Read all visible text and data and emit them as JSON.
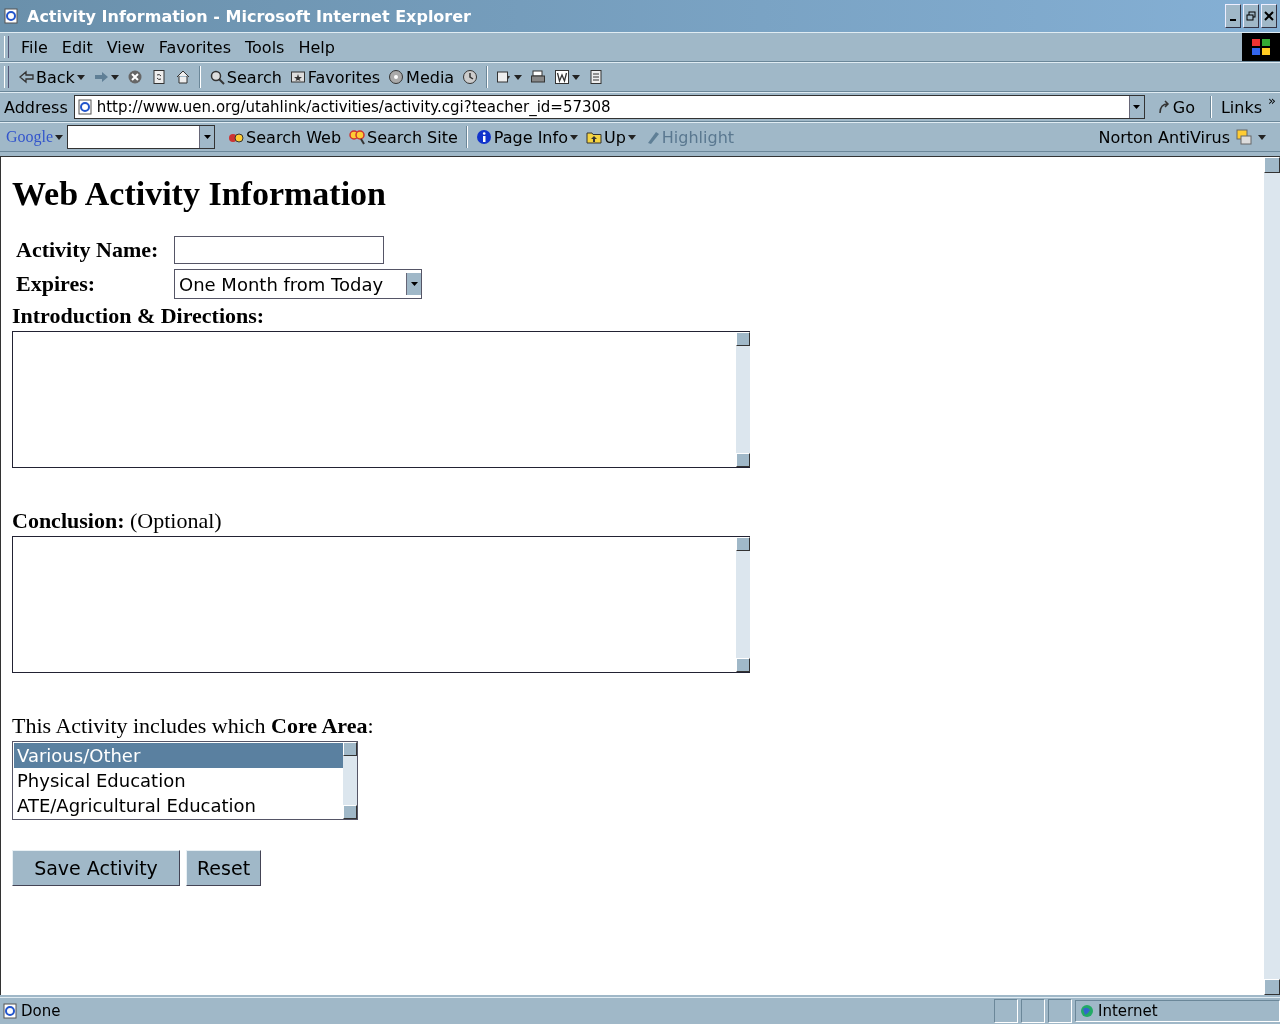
{
  "window": {
    "title": "Activity Information - Microsoft Internet Explorer"
  },
  "menu_bar": {
    "items": [
      "File",
      "Edit",
      "View",
      "Favorites",
      "Tools",
      "Help"
    ]
  },
  "toolbar": {
    "items": [
      {
        "kind": "back",
        "label": "Back",
        "disabled": false
      },
      {
        "kind": "forward",
        "disabled": true
      },
      {
        "kind": "stop"
      },
      {
        "kind": "refresh"
      },
      {
        "kind": "home"
      },
      {
        "kind": "search",
        "label": "Search"
      },
      {
        "kind": "favorites",
        "label": "Favorites"
      },
      {
        "kind": "media",
        "label": "Media"
      },
      {
        "kind": "history"
      },
      {
        "kind": "mail"
      },
      {
        "kind": "print"
      },
      {
        "kind": "word"
      },
      {
        "kind": "discuss"
      }
    ]
  },
  "address_bar": {
    "label": "Address",
    "url": "http://www.uen.org/utahlink/activities/activity.cgi?teacher_id=57308",
    "go": "Go",
    "links": "Links",
    "chevron": "»"
  },
  "google_bar": {
    "logo": "Google",
    "items": [
      {
        "kind": "search-web",
        "label": "Search Web",
        "disabled": false
      },
      {
        "kind": "search-site",
        "label": "Search Site",
        "disabled": false
      },
      {
        "kind": "page-info",
        "label": "Page Info",
        "disabled": false
      },
      {
        "kind": "up",
        "label": "Up",
        "disabled": false
      },
      {
        "kind": "highlight",
        "label": "Highlight",
        "disabled": true
      }
    ],
    "norton": "Norton AntiVirus"
  },
  "page": {
    "heading": "Web Activity Information",
    "activity_name": {
      "label": "Activity Name:"
    },
    "expires": {
      "label": "Expires:",
      "value": "One Month from Today"
    },
    "introduction": {
      "label": "Introduction & Directions:"
    },
    "conclusion": {
      "label": "**Conclusion:** (Optional)"
    },
    "core_area": {
      "prompt": "This Activity includes which **Core Area**:",
      "options": [
        {
          "label": "Various/Other",
          "selected": true
        },
        {
          "label": "Physical Education",
          "selected": false
        },
        {
          "label": "ATE/Agricultural Education",
          "selected": false
        }
      ]
    },
    "buttons": [
      "Save Activity",
      "Reset"
    ]
  },
  "status_bar": {
    "text": "Done",
    "zone": "Internet"
  }
}
